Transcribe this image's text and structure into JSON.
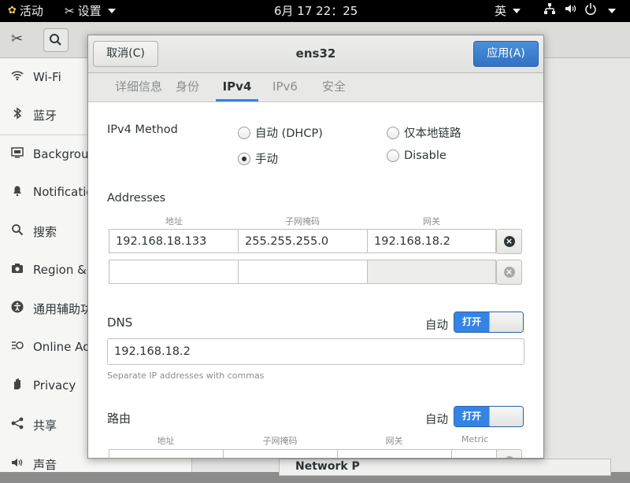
{
  "topbar": {
    "activities": "活动",
    "settings_menu": "设置",
    "clock": "6月 17 22：25",
    "input_method": "英"
  },
  "sidebar": {
    "items": [
      {
        "label": "Wi-Fi",
        "icon": "wifi-icon"
      },
      {
        "label": "蓝牙",
        "icon": "bluetooth-icon"
      },
      {
        "label": "Backgrou",
        "icon": "background-icon"
      },
      {
        "label": "Notificatio",
        "icon": "bell-icon"
      },
      {
        "label": "搜索",
        "icon": "search-icon"
      },
      {
        "label": "Region & L",
        "icon": "camera-icon"
      },
      {
        "label": "通用辅助功",
        "icon": "accessibility-icon"
      },
      {
        "label": "Online Acc",
        "icon": "online-accounts-icon"
      },
      {
        "label": "Privacy",
        "icon": "hand-icon"
      },
      {
        "label": "共享",
        "icon": "share-icon"
      },
      {
        "label": "声音",
        "icon": "sound-icon"
      }
    ]
  },
  "background_panel": {
    "strip_text": "Network P"
  },
  "dialog": {
    "title": "ens32",
    "cancel_label": "取消(C)",
    "apply_label": "应用(A)",
    "tabs": [
      "详细信息",
      "身份",
      "IPv4",
      "IPv6",
      "安全"
    ],
    "active_tab": "IPv4",
    "method_label": "IPv4 Method",
    "methods": [
      {
        "label": "自动 (DHCP)",
        "selected": false
      },
      {
        "label": "仅本地链路",
        "selected": false
      },
      {
        "label": "手动",
        "selected": true
      },
      {
        "label": "Disable",
        "selected": false
      }
    ],
    "addresses": {
      "title": "Addresses",
      "headers": [
        "地址",
        "子网掩码",
        "网关"
      ],
      "rows": [
        [
          "192.168.18.133",
          "255.255.255.0",
          "192.168.18.2"
        ],
        [
          "",
          "",
          ""
        ]
      ]
    },
    "dns": {
      "title": "DNS",
      "auto_label": "自动",
      "switch_label": "打开",
      "value": "192.168.18.2",
      "hint": "Separate IP addresses with commas"
    },
    "routes": {
      "title": "路由",
      "auto_label": "自动",
      "switch_label": "打开",
      "headers": [
        "地址",
        "子网掩码",
        "网关",
        "Metric"
      ]
    }
  }
}
